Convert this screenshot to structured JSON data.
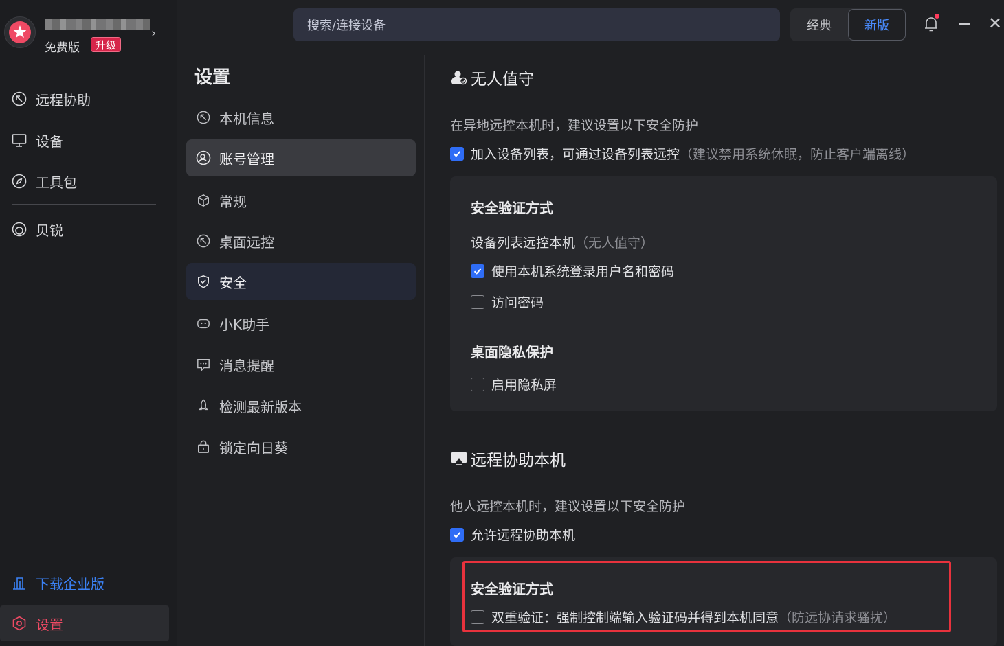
{
  "user": {
    "plan": "免费版",
    "upgrade": "升级"
  },
  "sidebar": {
    "items": [
      {
        "label": "远程协助",
        "icon": "remote-icon"
      },
      {
        "label": "设备",
        "icon": "monitor-icon"
      },
      {
        "label": "工具包",
        "icon": "compass-icon"
      },
      {
        "label": "贝锐",
        "icon": "oray-icon"
      }
    ],
    "download": "下载企业版",
    "settings": "设置"
  },
  "topbar": {
    "search_label": "搜索/连接设备",
    "classic": "经典",
    "new": "新版"
  },
  "settings_nav": {
    "title": "设置",
    "items": [
      {
        "label": "本机信息"
      },
      {
        "label": "账号管理"
      },
      {
        "label": "常规"
      },
      {
        "label": "桌面远控"
      },
      {
        "label": "安全"
      },
      {
        "label": "小K助手"
      },
      {
        "label": "消息提醒"
      },
      {
        "label": "检测最新版本"
      },
      {
        "label": "锁定向日葵"
      }
    ]
  },
  "content": {
    "unattended": {
      "title": "无人值守",
      "hint": "在异地远控本机时，建议设置以下安全防护",
      "add_device": {
        "label": "加入设备列表，可通过设备列表远控",
        "note": "（建议禁用系统休眠，防止客户端离线）",
        "checked": true
      },
      "card": {
        "auth_title": "安全验证方式",
        "sub": "设备列表远控本机",
        "sub_note": "（无人值守）",
        "opt_system_login": {
          "label": "使用本机系统登录用户名和密码",
          "checked": true
        },
        "opt_access_password": {
          "label": "访问密码",
          "checked": false
        },
        "privacy_title": "桌面隐私保护",
        "opt_privacy_screen": {
          "label": "启用隐私屏",
          "checked": false
        }
      }
    },
    "remote_assist": {
      "title": "远程协助本机",
      "hint": "他人远控本机时，建议设置以下安全防护",
      "allow": {
        "label": "允许远程协助本机",
        "checked": true
      },
      "card": {
        "auth_title": "安全验证方式",
        "two_factor": {
          "label": "双重验证：强制控制端输入验证码并得到本机同意",
          "note": "（防远协请求骚扰）",
          "checked": false
        }
      }
    }
  },
  "colors": {
    "accent_blue": "#2f6df6",
    "settings_red": "#ef4a64",
    "highlight_red": "#e8323d"
  }
}
